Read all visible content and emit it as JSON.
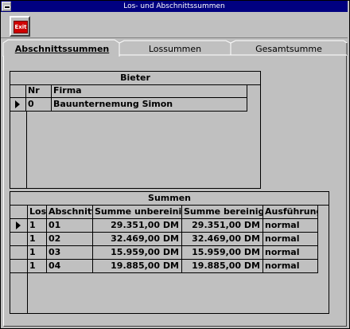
{
  "window": {
    "title": "Los- und Abschnittssummen"
  },
  "toolbar": {
    "exit_label": "Exit"
  },
  "tabs": [
    {
      "label": "Abschnittssummen",
      "active": true
    },
    {
      "label": "Lossummen",
      "active": false
    },
    {
      "label": "Gesamtsumme",
      "active": false
    }
  ],
  "bieter": {
    "title": "Bieter",
    "columns": [
      "Nr",
      "Firma"
    ],
    "rows": [
      {
        "nr": "0",
        "firma": "Bauunternemung Simon",
        "current": true
      }
    ]
  },
  "summen": {
    "title": "Summen",
    "columns": [
      "Los",
      "Abschnitt",
      "Summe unbereinigt",
      "Summe bereinigt",
      "Ausführung"
    ],
    "rows": [
      {
        "los": "1",
        "abschnitt": "01",
        "unbereinigt": "29.351,00 DM",
        "bereinigt": "29.351,00 DM",
        "ausfuehrung": "normal",
        "current": true
      },
      {
        "los": "1",
        "abschnitt": "02",
        "unbereinigt": "32.469,00 DM",
        "bereinigt": "32.469,00 DM",
        "ausfuehrung": "normal",
        "current": false
      },
      {
        "los": "1",
        "abschnitt": "03",
        "unbereinigt": "15.959,00 DM",
        "bereinigt": "15.959,00 DM",
        "ausfuehrung": "normal",
        "current": false
      },
      {
        "los": "1",
        "abschnitt": "04",
        "unbereinigt": "19.885,00 DM",
        "bereinigt": "19.885,00 DM",
        "ausfuehrung": "normal",
        "current": false
      }
    ]
  },
  "colors": {
    "titlebar": "#000080",
    "face": "#c0c0c0",
    "exit_icon": "#d00000"
  }
}
